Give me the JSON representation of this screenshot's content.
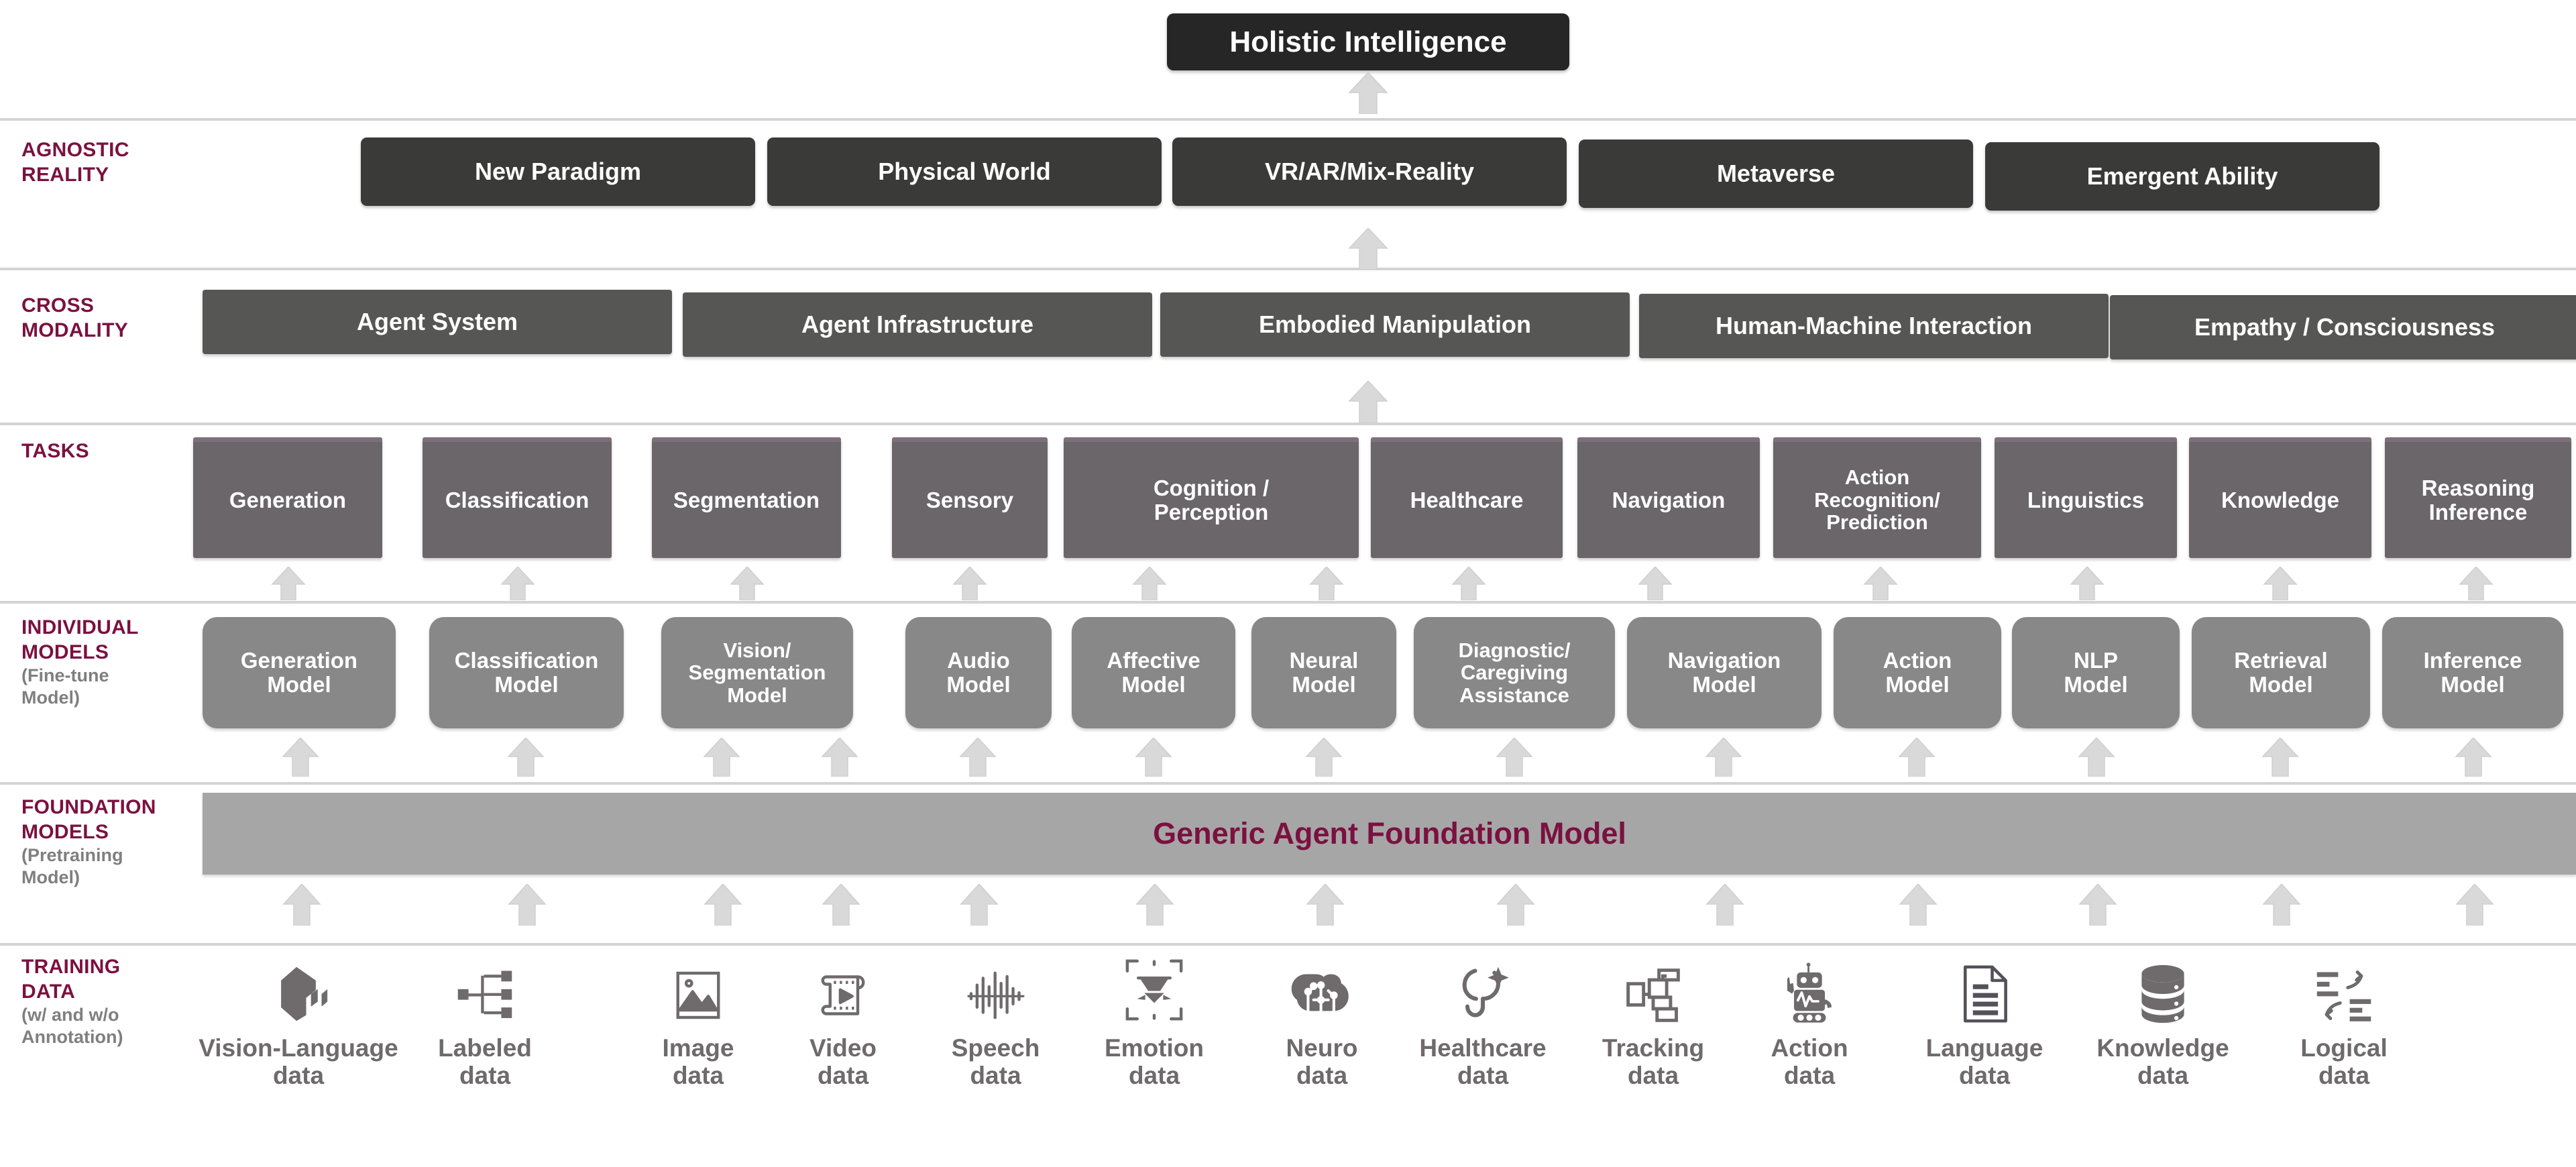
{
  "apex": {
    "label": "Holistic Intelligence"
  },
  "rows": [
    {
      "id": "agnostic-reality",
      "label": "AGNOSTIC\nREALITY",
      "sub": ""
    },
    {
      "id": "cross-modality",
      "label": "CROSS\nMODALITY",
      "sub": ""
    },
    {
      "id": "tasks",
      "label": "TASKS",
      "sub": ""
    },
    {
      "id": "individual-models",
      "label": "INDIVIDUAL\nMODELS",
      "sub": "(Fine-tune\nModel)"
    },
    {
      "id": "foundation-models",
      "label": "FOUNDATION\nMODELS",
      "sub": "(Pretraining\nModel)"
    },
    {
      "id": "training-data",
      "label": "TRAINING\nDATA",
      "sub": "(w/ and w/o\nAnnotation)"
    }
  ],
  "agnostic_reality": {
    "items": [
      {
        "label": "New Paradigm"
      },
      {
        "label": "Physical World"
      },
      {
        "label": "VR/AR/Mix-Reality"
      },
      {
        "label": "Metaverse"
      },
      {
        "label": "Emergent Ability"
      }
    ]
  },
  "cross_modality": {
    "items": [
      {
        "label": "Agent System"
      },
      {
        "label": "Agent Infrastructure"
      },
      {
        "label": "Embodied Manipulation"
      },
      {
        "label": "Human-Machine Interaction"
      },
      {
        "label": "Empathy / Consciousness"
      }
    ]
  },
  "tasks": {
    "items": [
      {
        "label": "Generation"
      },
      {
        "label": "Classification"
      },
      {
        "label": "Segmentation"
      },
      {
        "label": "Sensory"
      },
      {
        "label": "Cognition /\nPerception"
      },
      {
        "label": "Healthcare"
      },
      {
        "label": "Navigation"
      },
      {
        "label": "Action\nRecognition/\nPrediction"
      },
      {
        "label": "Linguistics"
      },
      {
        "label": "Knowledge"
      },
      {
        "label": "Reasoning\nInference"
      }
    ]
  },
  "individual_models": {
    "items": [
      {
        "label": "Generation\nModel"
      },
      {
        "label": "Classification\nModel"
      },
      {
        "label": "Vision/\nSegmentation\nModel"
      },
      {
        "label": "Audio\nModel"
      },
      {
        "label": "Affective\nModel"
      },
      {
        "label": "Neural\nModel"
      },
      {
        "label": "Diagnostic/\nCaregiving\nAssistance"
      },
      {
        "label": "Navigation\nModel"
      },
      {
        "label": "Action\nModel"
      },
      {
        "label": "NLP\nModel"
      },
      {
        "label": "Retrieval\nModel"
      },
      {
        "label": "Inference\nModel"
      }
    ]
  },
  "foundation_models": {
    "label": "Generic Agent Foundation Model"
  },
  "training_data": {
    "items": [
      {
        "label": "Vision-Language\ndata",
        "icon": "cube-3d-icon"
      },
      {
        "label": "Labeled\ndata",
        "icon": "hierarchy-nodes-icon"
      },
      {
        "label": "Image\ndata",
        "icon": "picture-mountain-icon"
      },
      {
        "label": "Video\ndata",
        "icon": "film-play-icon"
      },
      {
        "label": "Speech\ndata",
        "icon": "waveform-icon"
      },
      {
        "label": "Emotion\ndata",
        "icon": "face-scan-icon"
      },
      {
        "label": "Neuro\ndata",
        "icon": "brain-circuit-icon"
      },
      {
        "label": "Healthcare\ndata",
        "icon": "stethoscope-sparkle-icon"
      },
      {
        "label": "Tracking\ndata",
        "icon": "bounding-boxes-icon"
      },
      {
        "label": "Action\ndata",
        "icon": "robot-icon"
      },
      {
        "label": "Language\ndata",
        "icon": "document-lines-icon"
      },
      {
        "label": "Knowledge\ndata",
        "icon": "database-icon"
      },
      {
        "label": "Logical\ndata",
        "icon": "logic-flow-icon"
      }
    ]
  },
  "colors": {
    "accent": "#7B1140",
    "apex": "#262626",
    "agnostic": "#3a3a38",
    "cross": "#565654",
    "task": "#6a666a",
    "individual": "#888888",
    "foundation": "#a6a6a6",
    "arrow": "#d9d9d9",
    "icon": "#6f6a6c",
    "separator": "#d3d3d3",
    "sublabel": "#7f7f7f"
  }
}
